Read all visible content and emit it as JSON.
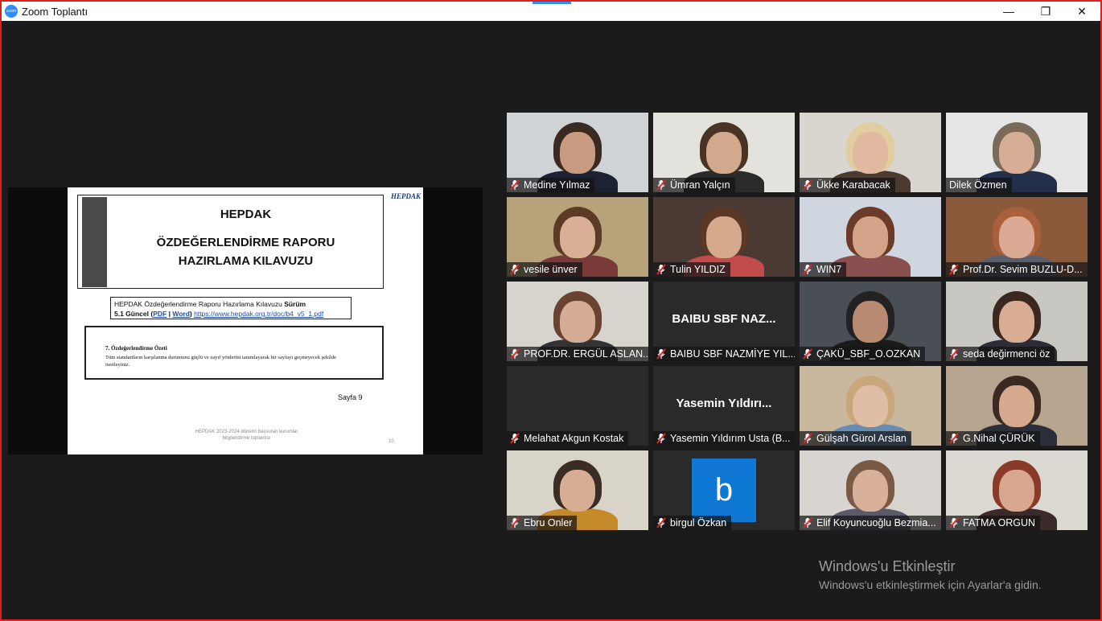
{
  "window": {
    "title": "Zoom Toplantı",
    "logo_text": "zoom",
    "buttons": {
      "minimize": "—",
      "maximize": "❐",
      "close": "✕"
    }
  },
  "slide": {
    "logo": "HEPDAK",
    "title": "HEPDAK",
    "subtitle_line1": "ÖZDEĞERLENDİRME RAPORU",
    "subtitle_line2": "HAZIRLAMA KILAVUZU",
    "guide_text": "HEPDAK Özdeğerlendirme Raporu Hazırlama Kılavuzu",
    "guide_version_1": "Sürüm",
    "guide_version_2": "5.1 Güncel",
    "pdf_link": "PDF",
    "word_link": "Word",
    "url": "https://www.hepdak.org.tr/doc/b4_v5_1.pdf",
    "section_title": "7. Özdeğerlendirme Özeti",
    "section_text": "Tüm standartların karşılanma durumunu güçlü ve zayıf yönlerini tanımlayarak bir sayfayı geçmeyecek şekilde özetleyiniz.",
    "page_label": "Sayfa 9",
    "footer": "HEPDAK 2023-2024 dönemi başvuran kurumlar bilgilendirme toplantısı",
    "slide_number": "10"
  },
  "participants": [
    {
      "name": "Medine Yılmaz",
      "muted": true,
      "active": false,
      "kind": "video",
      "bg": "#cfd3d6",
      "skin": "#c99b80",
      "hair": "#3a2a22",
      "shirt": "#1c2233"
    },
    {
      "name": "Ümran Yalçın",
      "muted": true,
      "active": false,
      "kind": "video",
      "bg": "#e4e2dd",
      "skin": "#d2a98c",
      "hair": "#4a3324",
      "shirt": "#2a2a2a"
    },
    {
      "name": "Ükke Karabacak",
      "muted": true,
      "active": false,
      "kind": "video",
      "bg": "#d9d6cf",
      "skin": "#e0b9a0",
      "hair": "#e0cda0",
      "shirt": "#4b3a2f"
    },
    {
      "name": "Dilek Özmen",
      "muted": false,
      "active": true,
      "kind": "video",
      "bg": "#e6e6e6",
      "skin": "#d8ad95",
      "hair": "#7a6a5a",
      "shirt": "#24304a"
    },
    {
      "name": "vesile ünver",
      "muted": true,
      "active": false,
      "kind": "video",
      "bg": "#b8a27a",
      "skin": "#d9b095",
      "hair": "#5b3b25",
      "shirt": "#7a3a3a"
    },
    {
      "name": "Tulin YILDIZ",
      "muted": true,
      "active": false,
      "kind": "video",
      "bg": "#4a3a33",
      "skin": "#d5a98b",
      "hair": "#5a3825",
      "shirt": "#c24b4b"
    },
    {
      "name": "WIN7",
      "muted": true,
      "active": false,
      "kind": "video",
      "bg": "#cfd6e0",
      "skin": "#d3a48a",
      "hair": "#6b3a28",
      "shirt": "#8a4f4f"
    },
    {
      "name": "Prof.Dr. Sevim BUZLU-D...",
      "muted": true,
      "active": false,
      "kind": "video",
      "bg": "#8b5a3a",
      "skin": "#dba994",
      "hair": "#a8613a",
      "shirt": "#5a5f6e"
    },
    {
      "name": "PROF.DR. ERGÜL ASLAN...",
      "muted": true,
      "active": false,
      "kind": "video",
      "bg": "#d7d3cd",
      "skin": "#d5ad96",
      "hair": "#6a4330",
      "shirt": "#333333"
    },
    {
      "name": "BAIBU SBF NAZMİYE YIL...",
      "muted": true,
      "active": false,
      "kind": "text",
      "big": "BAIBU SBF NAZ..."
    },
    {
      "name": "ÇAKÜ_SBF_O.OZKAN",
      "muted": true,
      "active": false,
      "kind": "video",
      "bg": "#4a4f55",
      "skin": "#b88a72",
      "hair": "#222222",
      "shirt": "#1a1a1a"
    },
    {
      "name": "seda değirmenci öz",
      "muted": true,
      "active": false,
      "kind": "video",
      "bg": "#c9c7c2",
      "skin": "#d9ad94",
      "hair": "#3a2820",
      "shirt": "#2d2d35"
    },
    {
      "name": "Melahat Akgun Kostak",
      "muted": true,
      "active": false,
      "kind": "empty"
    },
    {
      "name": "Yasemin Yıldırım Usta (B...",
      "muted": true,
      "active": false,
      "kind": "text",
      "big": "Yasemin  Yıldırı..."
    },
    {
      "name": "Gülşah Gürol Arslan",
      "muted": true,
      "active": false,
      "kind": "video",
      "bg": "#c9b89e",
      "skin": "#e0bda5",
      "hair": "#c9a77a",
      "shirt": "#6a8cb0"
    },
    {
      "name": "G.Nihal ÇÜRÜK",
      "muted": true,
      "active": false,
      "kind": "video",
      "bg": "#b8a590",
      "skin": "#d6a98f",
      "hair": "#3a2a22",
      "shirt": "#2a2f3a"
    },
    {
      "name": "Ebru Onler",
      "muted": true,
      "active": false,
      "kind": "video",
      "bg": "#d9d4ca",
      "skin": "#d7ae93",
      "hair": "#3a2d25",
      "shirt": "#c48a2a"
    },
    {
      "name": "birgul Özkan",
      "muted": true,
      "active": false,
      "kind": "avatar",
      "letter": "b"
    },
    {
      "name": "Elif Koyuncuoğlu Bezmia...",
      "muted": true,
      "active": false,
      "kind": "video",
      "bg": "#d8d4cf",
      "skin": "#d9b09a",
      "hair": "#7a5a45",
      "shirt": "#5a5a6a"
    },
    {
      "name": "FATMA ORGUN",
      "muted": true,
      "active": false,
      "kind": "video",
      "bg": "#dcd8d2",
      "skin": "#d8a78f",
      "hair": "#8a3a28",
      "shirt": "#3a2a2a"
    }
  ],
  "watermark": {
    "title": "Windows'u Etkinleştir",
    "subtitle": "Windows'u etkinleştirmek için Ayarlar'a gidin."
  }
}
